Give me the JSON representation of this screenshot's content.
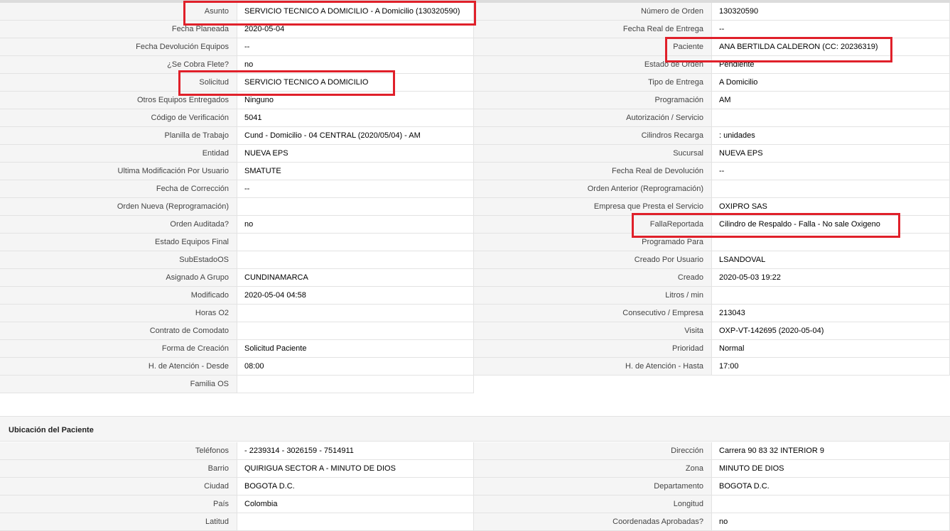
{
  "details": {
    "rows": [
      {
        "left_label": "Asunto",
        "left_value": "SERVICIO TECNICO A DOMICILIO - A Domicilio (130320590)",
        "right_label": "Número de Orden",
        "right_value": "130320590"
      },
      {
        "left_label": "Fecha Planeada",
        "left_value": "2020-05-04",
        "right_label": "Fecha Real de Entrega",
        "right_value": "--"
      },
      {
        "left_label": "Fecha Devolución Equipos",
        "left_value": "--",
        "right_label": "Paciente",
        "right_value": "ANA BERTILDA CALDERON (CC: 20236319)"
      },
      {
        "left_label": "¿Se Cobra Flete?",
        "left_value": "no",
        "right_label": "Estado de Orden",
        "right_value": "Pendiente"
      },
      {
        "left_label": "Solicitud",
        "left_value": "SERVICIO TECNICO A DOMICILIO",
        "right_label": "Tipo de Entrega",
        "right_value": "A Domicilio"
      },
      {
        "left_label": "Otros Equipos Entregados",
        "left_value": "Ninguno",
        "right_label": "Programación",
        "right_value": "AM"
      },
      {
        "left_label": "Código de Verificación",
        "left_value": "5041",
        "right_label": "Autorización / Servicio",
        "right_value": ""
      },
      {
        "left_label": "Planilla de Trabajo",
        "left_value": "Cund - Domicilio - 04 CENTRAL (2020/05/04) - AM",
        "right_label": "Cilindros Recarga",
        "right_value": ": unidades"
      },
      {
        "left_label": "Entidad",
        "left_value": "NUEVA EPS",
        "right_label": "Sucursal",
        "right_value": "NUEVA EPS"
      },
      {
        "left_label": "Ultima Modificación Por Usuario",
        "left_value": "SMATUTE",
        "right_label": "Fecha Real de Devolución",
        "right_value": "--"
      },
      {
        "left_label": "Fecha de Corrección",
        "left_value": "--",
        "right_label": "Orden Anterior (Reprogramación)",
        "right_value": ""
      },
      {
        "left_label": "Orden Nueva (Reprogramación)",
        "left_value": "",
        "right_label": "Empresa que Presta el Servicio",
        "right_value": "OXIPRO SAS"
      },
      {
        "left_label": "Orden Auditada?",
        "left_value": "no",
        "right_label": "FallaReportada",
        "right_value": "Cilindro de Respaldo - Falla - No sale Oxigeno"
      },
      {
        "left_label": "Estado Equipos Final",
        "left_value": "",
        "right_label": "Programado Para",
        "right_value": ""
      },
      {
        "left_label": "SubEstadoOS",
        "left_value": "",
        "right_label": "Creado Por Usuario",
        "right_value": "LSANDOVAL"
      },
      {
        "left_label": "Asignado A Grupo",
        "left_value": "CUNDINAMARCA",
        "right_label": "Creado",
        "right_value": "2020-05-03 19:22"
      },
      {
        "left_label": "Modificado",
        "left_value": "2020-05-04 04:58",
        "right_label": "Litros / min",
        "right_value": ""
      },
      {
        "left_label": "Horas O2",
        "left_value": "",
        "right_label": "Consecutivo / Empresa",
        "right_value": "213043"
      },
      {
        "left_label": "Contrato de Comodato",
        "left_value": "",
        "right_label": "Visita",
        "right_value": "OXP-VT-142695 (2020-05-04)"
      },
      {
        "left_label": "Forma de Creación",
        "left_value": "Solicitud Paciente",
        "right_label": "Prioridad",
        "right_value": "Normal"
      },
      {
        "left_label": "H. de Atención - Desde",
        "left_value": "08:00",
        "right_label": "H. de Atención - Hasta",
        "right_value": "17:00"
      }
    ],
    "last_left_label": "Familia OS",
    "last_left_value": ""
  },
  "location": {
    "title": "Ubicación del Paciente",
    "rows": [
      {
        "left_label": "Teléfonos",
        "left_value": "- 2239314 - 3026159 - 7514911",
        "right_label": "Dirección",
        "right_value": "Carrera 90 83 32 INTERIOR 9"
      },
      {
        "left_label": "Barrio",
        "left_value": "QUIRIGUA SECTOR A - MINUTO DE DIOS",
        "right_label": "Zona",
        "right_value": "MINUTO DE DIOS"
      },
      {
        "left_label": "Ciudad",
        "left_value": "BOGOTA D.C.",
        "right_label": "Departamento",
        "right_value": "BOGOTA D.C."
      },
      {
        "left_label": "País",
        "left_value": "Colombia",
        "right_label": "Longitud",
        "right_value": ""
      },
      {
        "left_label": "Latitud",
        "left_value": "",
        "right_label": "Coordenadas Aprobadas?",
        "right_value": "no"
      }
    ]
  },
  "highlight_color": "#e0202a"
}
